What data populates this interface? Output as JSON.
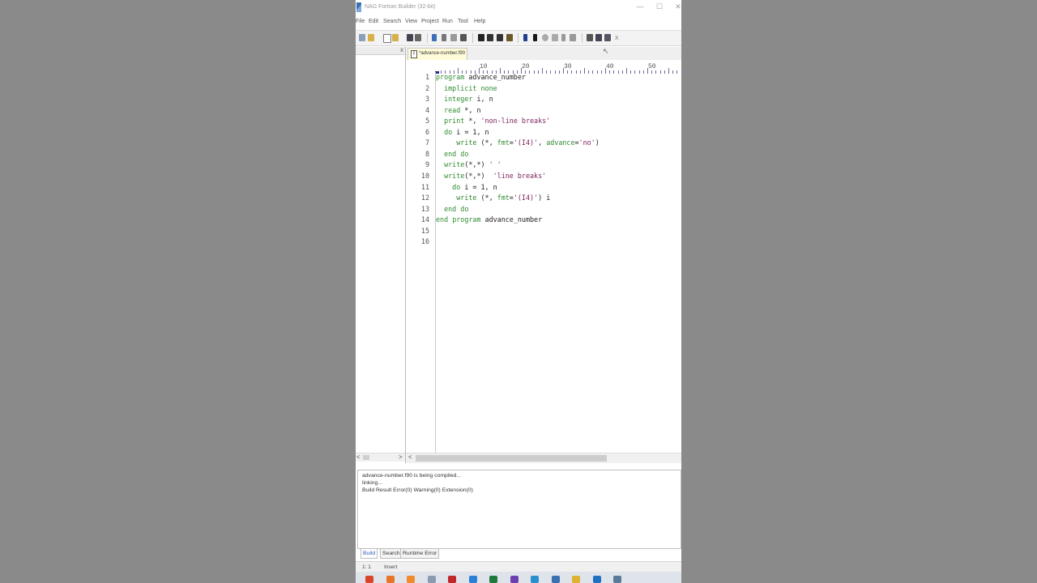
{
  "window": {
    "title": "NAG Fortran Builder (32-bit)",
    "minimize": "—",
    "maximize": "☐",
    "close": "✕"
  },
  "menu": [
    "File",
    "Edit",
    "Search",
    "View",
    "Project",
    "Run",
    "Tool",
    "Help"
  ],
  "toolbar": {
    "icons": [
      "new-project-icon",
      "open-icon",
      "new-file-icon",
      "open-file-icon",
      "save-icon",
      "print-icon",
      "undo-icon",
      "cut-icon",
      "copy-icon",
      "paste-icon",
      "find-icon",
      "find-next-icon",
      "find-prev-icon",
      "replace-icon",
      "build-icon",
      "run-icon",
      "debug-icon",
      "step-icon",
      "stop-icon",
      "tile-icon",
      "window-icon",
      "window2-icon"
    ],
    "close": "x"
  },
  "left_panel": {
    "close": "x",
    "scroll_left": "<",
    "scroll_right": ">"
  },
  "editor": {
    "tab_name": "*advance-number.f90",
    "ruler_numbers": [
      "10",
      "20",
      "30",
      "40",
      "50"
    ],
    "lines": [
      {
        "n": "1",
        "code": "program advance_number"
      },
      {
        "n": "2",
        "code": "  implicit none"
      },
      {
        "n": "3",
        "code": "  integer i, n"
      },
      {
        "n": "4",
        "code": "  read *, n"
      },
      {
        "n": "5",
        "code": "  print *, 'non-line breaks'"
      },
      {
        "n": "6",
        "code": "  do i = 1, n"
      },
      {
        "n": "7",
        "code": "     write (*, fmt='(I4)', advance='no')"
      },
      {
        "n": "8",
        "code": "  end do"
      },
      {
        "n": "9",
        "code": "  write(*,*) ' '"
      },
      {
        "n": "10",
        "code": "  write(*,*)  'line breaks'"
      },
      {
        "n": "11",
        "code": "    do i = 1, n"
      },
      {
        "n": "12",
        "code": "     write (*, fmt='(I4)') i"
      },
      {
        "n": "13",
        "code": "  end do"
      },
      {
        "n": "14",
        "code": "end program advance_number"
      },
      {
        "n": "15",
        "code": ""
      },
      {
        "n": "16",
        "code": ""
      }
    ],
    "scroll_left": "<"
  },
  "output": {
    "lines": [
      "advance-number.f90 is being compiled...",
      "linking...",
      "Build Result Error(0) Warning(0) Extension(0)"
    ],
    "tabs": [
      "Build",
      "Search",
      "Runtime Error"
    ]
  },
  "status": {
    "position": "1:   1",
    "mode": "Insert"
  },
  "taskbar": {
    "colors": [
      "#d9452b",
      "#e8742a",
      "#f08a2c",
      "#8a9ab0",
      "#c0262a",
      "#2b7fd4",
      "#1f7a3e",
      "#6a3fb0",
      "#2a8fd0",
      "#3a6fb0",
      "#e0b030",
      "#2070c0",
      "#5a7a9a"
    ]
  }
}
